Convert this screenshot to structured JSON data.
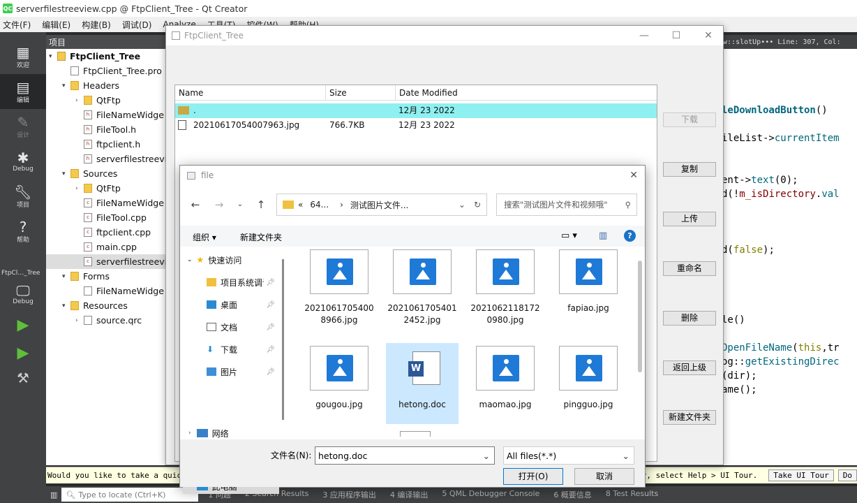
{
  "qt": {
    "title": "serverfilestreeview.cpp @ FtpClient_Tree - Qt Creator",
    "menu": [
      "文件(F)",
      "编辑(E)",
      "构建(B)",
      "调试(D)",
      "Analyze",
      "工具(T)",
      "控件(W)",
      "帮助(H)"
    ],
    "modes": [
      {
        "icon": "grid-icon",
        "label": "欢迎"
      },
      {
        "icon": "edit-icon",
        "label": "编辑"
      },
      {
        "icon": "design-icon",
        "label": "设计"
      },
      {
        "icon": "bug-icon",
        "label": "Debug"
      },
      {
        "icon": "wrench-icon",
        "label": "项目"
      },
      {
        "icon": "help-icon",
        "label": "帮助"
      }
    ],
    "kit_label": "FtpCl…_Tree",
    "kit_mode": "Debug",
    "project_header": "项目",
    "tree": [
      {
        "level": 0,
        "arrow": "▾",
        "icon": "pro",
        "label": "FtpClient_Tree",
        "bold": true
      },
      {
        "level": 1,
        "arrow": "",
        "icon": "file",
        "label": "FtpClient_Tree.pro"
      },
      {
        "level": 1,
        "arrow": "▾",
        "icon": "folder",
        "label": "Headers"
      },
      {
        "level": 2,
        "arrow": "›",
        "icon": "folder",
        "label": "QtFtp"
      },
      {
        "level": 2,
        "arrow": "",
        "icon": "h",
        "label": "FileNameWidge"
      },
      {
        "level": 2,
        "arrow": "",
        "icon": "h",
        "label": "FileTool.h"
      },
      {
        "level": 2,
        "arrow": "",
        "icon": "h",
        "label": "ftpclient.h"
      },
      {
        "level": 2,
        "arrow": "",
        "icon": "h",
        "label": "serverfilestreevi"
      },
      {
        "level": 1,
        "arrow": "▾",
        "icon": "folder",
        "label": "Sources"
      },
      {
        "level": 2,
        "arrow": "›",
        "icon": "folder",
        "label": "QtFtp"
      },
      {
        "level": 2,
        "arrow": "",
        "icon": "c",
        "label": "FileNameWidge"
      },
      {
        "level": 2,
        "arrow": "",
        "icon": "c",
        "label": "FileTool.cpp"
      },
      {
        "level": 2,
        "arrow": "",
        "icon": "c",
        "label": "ftpclient.cpp"
      },
      {
        "level": 2,
        "arrow": "",
        "icon": "c",
        "label": "main.cpp"
      },
      {
        "level": 2,
        "arrow": "",
        "icon": "c",
        "label": "serverfilestreevi",
        "selected": true
      },
      {
        "level": 1,
        "arrow": "▾",
        "icon": "folder",
        "label": "Forms"
      },
      {
        "level": 2,
        "arrow": "",
        "icon": "ui",
        "label": "FileNameWidge"
      },
      {
        "level": 1,
        "arrow": "▾",
        "icon": "folder",
        "label": "Resources"
      },
      {
        "level": 2,
        "arrow": "›",
        "icon": "qrc",
        "label": "source.qrc"
      }
    ],
    "editor_toolbar": "ew::slotUp•••   Line: 307, Col:",
    "code": [
      "leDownloadButton()",
      "ileList->currentItem",
      "ent->text(0);",
      "d(!m_isDirectory.val",
      "d(false);",
      "le()",
      "OpenFileName(this,tr",
      "og::getExistingDirec",
      "(dir);",
      "ame();"
    ],
    "bottom_msg": "Would you like to take a quick U",
    "bottom_msg_right": "ter, select Help > UI Tour.",
    "take_tour": "Take UI Tour",
    "do_not": "Do",
    "locate_placeholder": "Type to locate (Ctrl+K)",
    "status_tabs": [
      "1 问题",
      "2 Search Results",
      "3 应用程序输出",
      "4 编译输出",
      "5 QML Debugger Console",
      "6 概要信息",
      "8 Test Results"
    ]
  },
  "ftp": {
    "title": "FtpClient_Tree",
    "columns": [
      "Name",
      "Size",
      "Date Modified"
    ],
    "rows": [
      {
        "name": ".",
        "size": "",
        "date": "12月 23 2022",
        "type": "folder",
        "selected": true
      },
      {
        "name": "20210617054007963.jpg",
        "size": "766.7KB",
        "date": "12月 23 2022",
        "type": "file"
      }
    ],
    "buttons": [
      "下载",
      "复制",
      "上传",
      "重命名",
      "删除",
      "返回上级",
      "新建文件夹"
    ]
  },
  "file_dialog": {
    "title": "file",
    "address": [
      "«",
      "64...",
      "›",
      "测试图片文件..."
    ],
    "search_placeholder": "搜索\"测试图片文件和视频哦\"",
    "organize": "组织 ▾",
    "new_folder": "新建文件夹",
    "nav": [
      {
        "label": "快速访问",
        "icon": "star-icon"
      },
      {
        "label": "项目系统调试",
        "icon": "folder-icon"
      },
      {
        "label": "桌面",
        "icon": "desktop-icon"
      },
      {
        "label": "文档",
        "icon": "document-icon"
      },
      {
        "label": "下载",
        "icon": "download-icon"
      },
      {
        "label": "图片",
        "icon": "picture-icon"
      },
      {
        "label": "此电脑",
        "icon": "pc-icon"
      },
      {
        "label": "网络",
        "icon": "network-icon"
      }
    ],
    "files": [
      {
        "name": "20210617054008966.jpg",
        "kind": "image"
      },
      {
        "name": "20210617054012452.jpg",
        "kind": "image"
      },
      {
        "name": "20210621181720980.jpg",
        "kind": "image"
      },
      {
        "name": "fapiao.jpg",
        "kind": "image"
      },
      {
        "name": "gougou.jpg",
        "kind": "image"
      },
      {
        "name": "hetong.doc",
        "kind": "doc",
        "selected": true
      },
      {
        "name": "maomao.jpg",
        "kind": "image"
      },
      {
        "name": "pingguo.jpg",
        "kind": "image"
      }
    ],
    "filename_label": "文件名(N):",
    "filename_value": "hetong.doc",
    "filter": "All files(*.*)",
    "open": "打开(O)",
    "cancel": "取消"
  }
}
